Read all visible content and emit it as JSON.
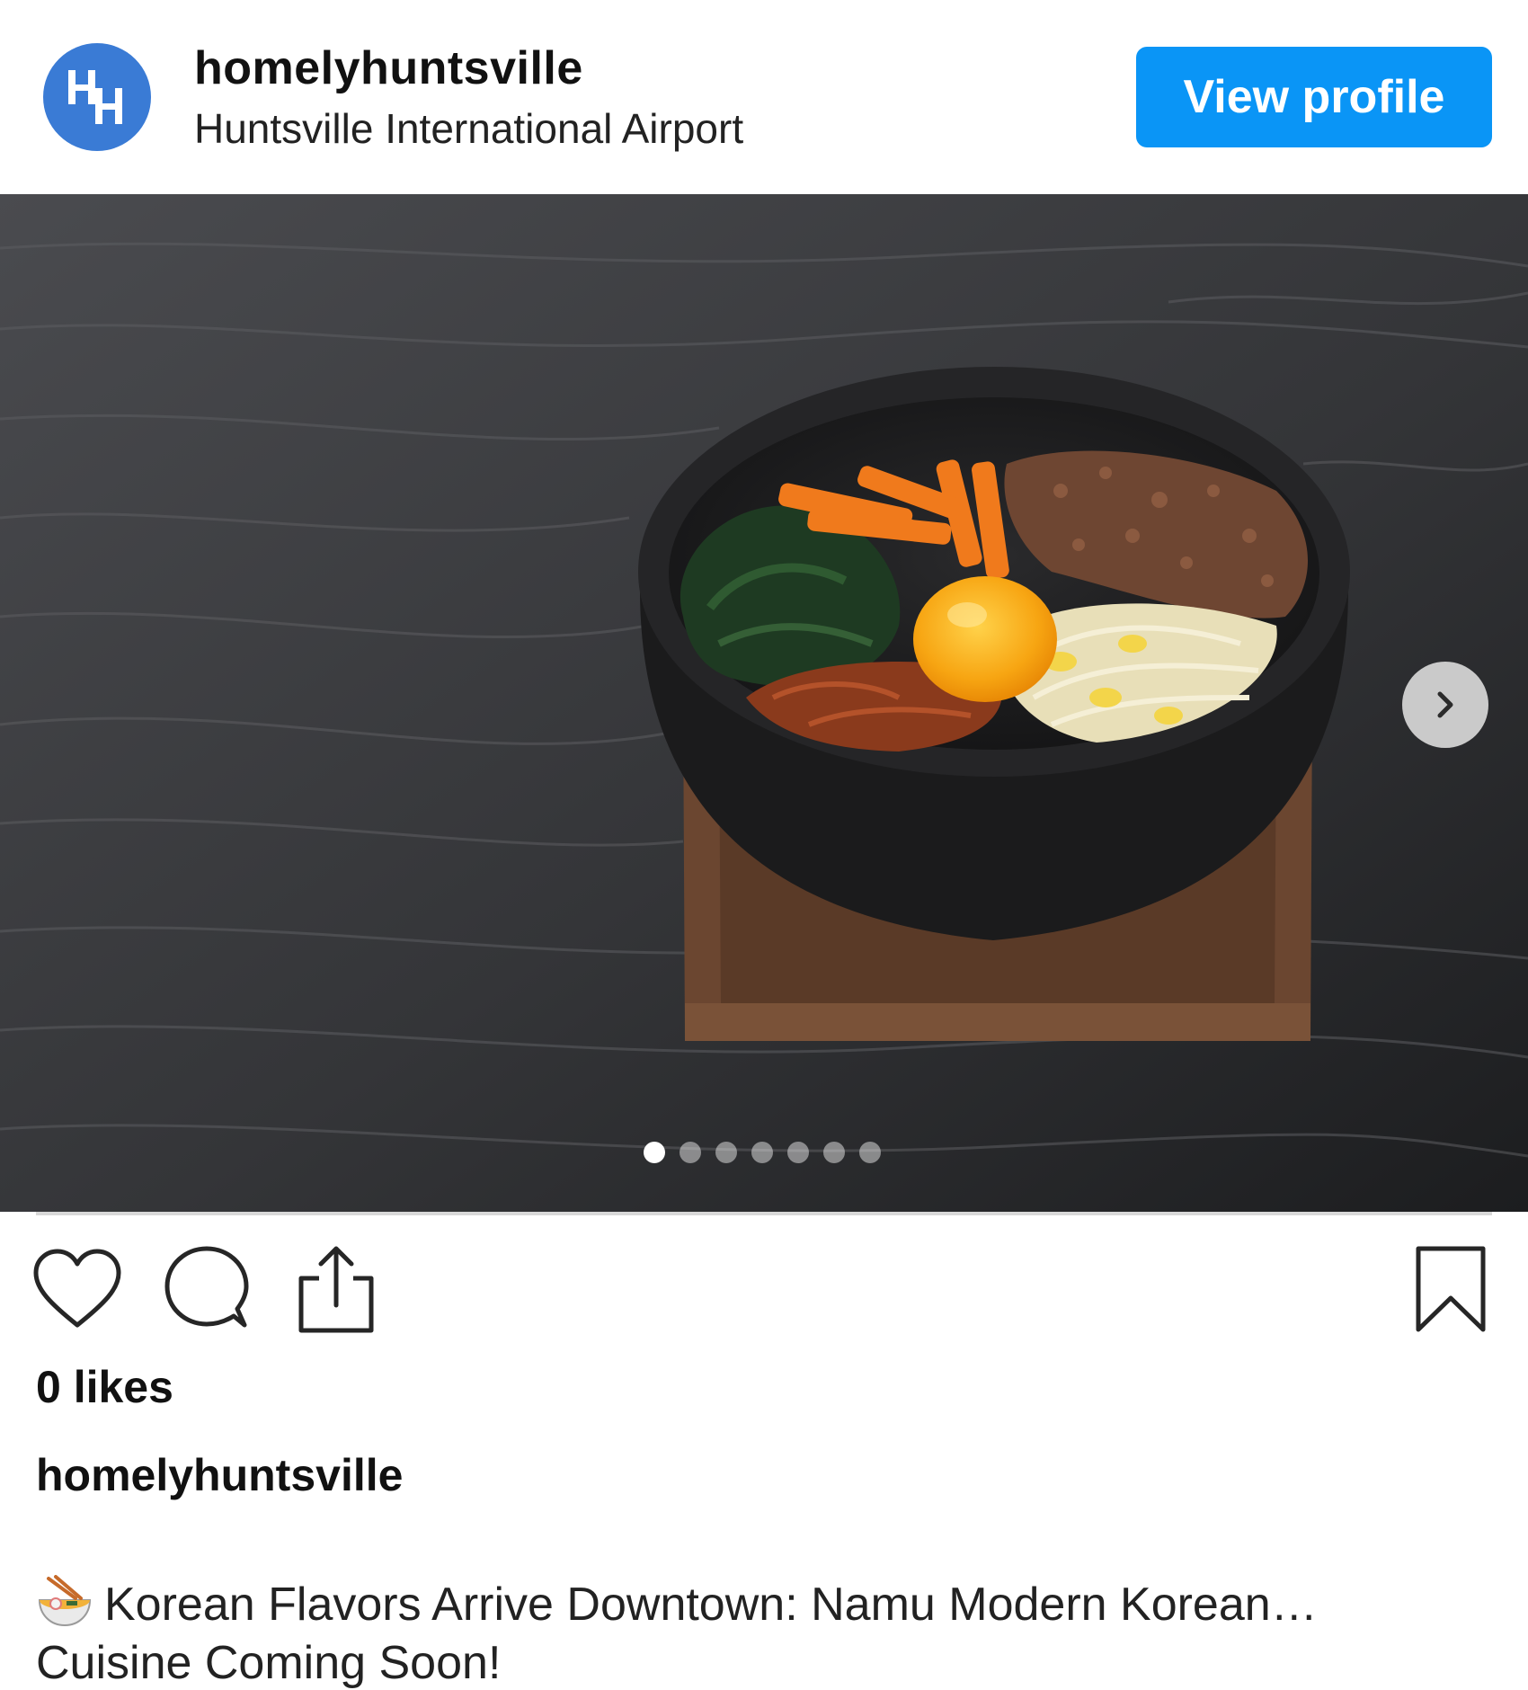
{
  "post": {
    "username": "homelyhuntsville",
    "location": "Huntsville International Airport",
    "view_profile_label": "View profile",
    "avatar_monogram": "HH",
    "likes_text": "0 likes",
    "caption_username": "homelyhuntsville",
    "caption_emoji": "ramen-bowl-icon",
    "caption_line1": "Korean Flavors Arrive Downtown: Namu Modern Korean…",
    "caption_line2": "Cuisine Coming Soon!",
    "carousel": {
      "total_slides": 7,
      "active_slide": 1
    }
  },
  "colors": {
    "accent": "#0a95f6",
    "avatar_bg": "#3a7bd5"
  }
}
